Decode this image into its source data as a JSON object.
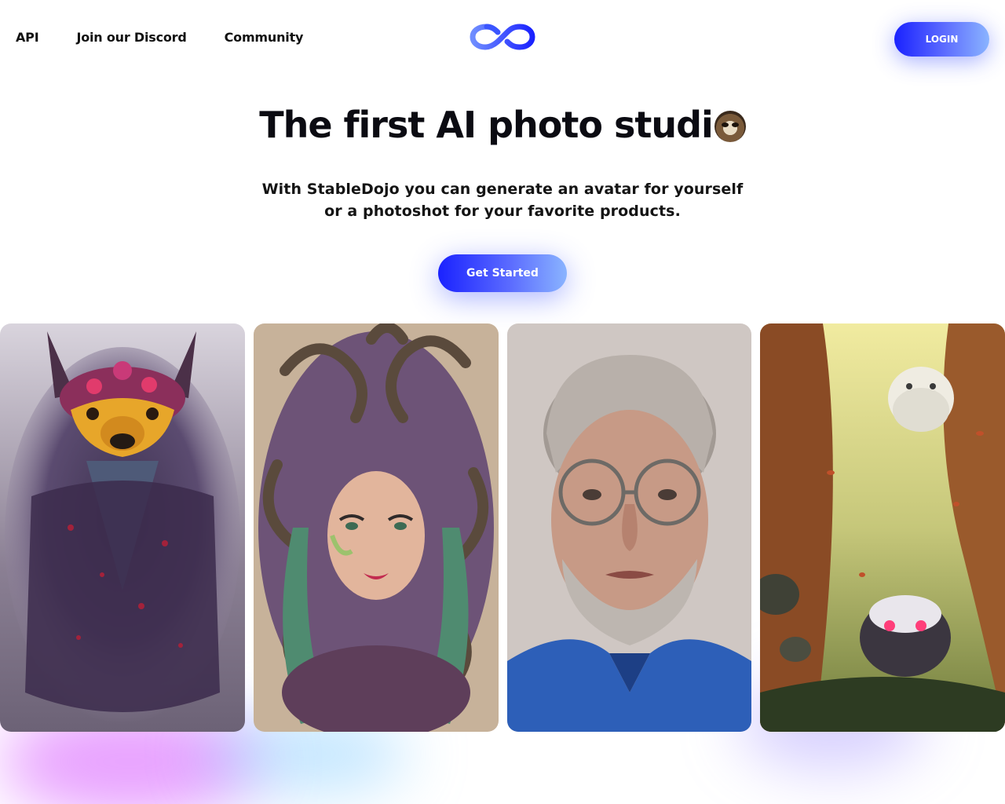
{
  "nav": {
    "links": [
      "API",
      "Join our Discord",
      "Community"
    ],
    "login_label": "LOGIN"
  },
  "hero": {
    "title": "The first AI photo studi",
    "subtitle": "With StableDojo you can generate an avatar for yourself or a photoshot for your favorite products.",
    "cta_label": "Get Started"
  },
  "gallery": {
    "images": [
      "creature-portrait-image",
      "medusa-portrait-image",
      "older-man-glasses-portrait-image",
      "cute-creatures-forest-image"
    ]
  },
  "colors": {
    "accent": "#1a22ff",
    "accent_light": "#8ab4ff"
  }
}
